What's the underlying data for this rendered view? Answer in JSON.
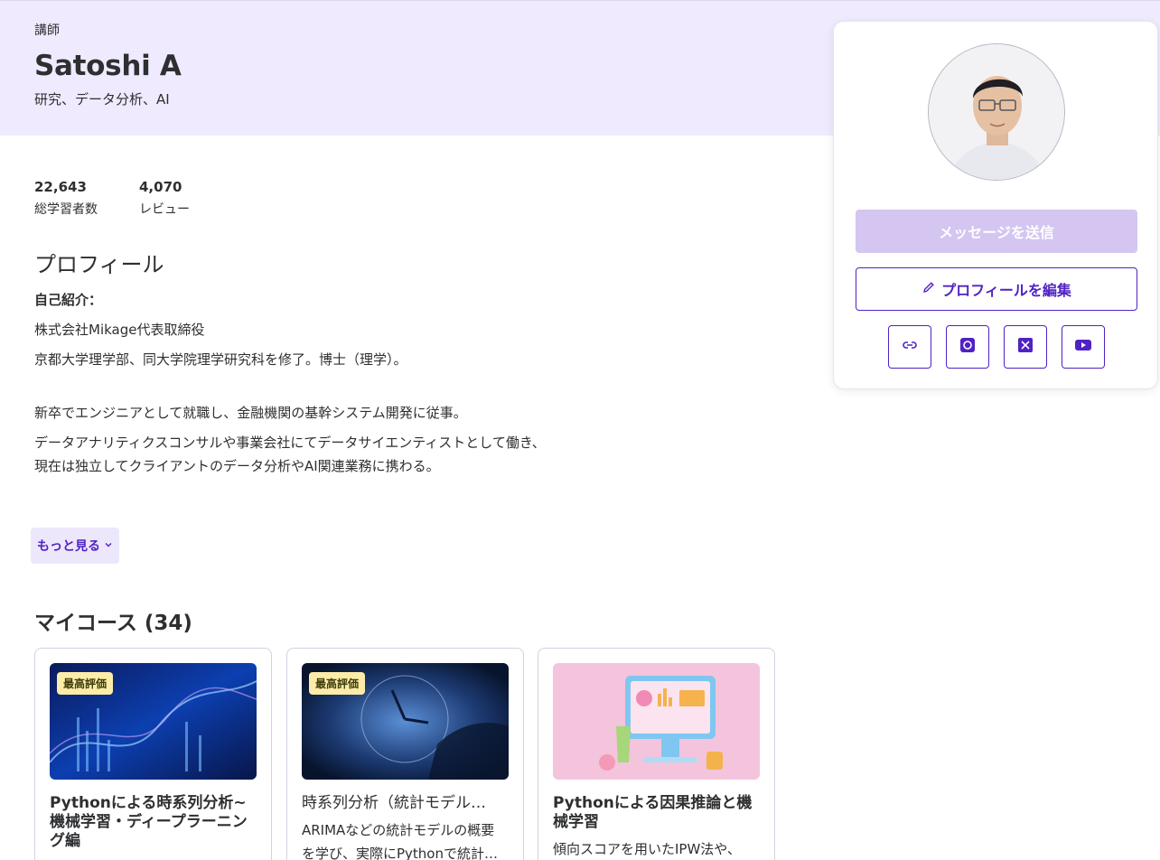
{
  "header": {
    "role": "講師",
    "name": "Satoshi A",
    "tagline": "研究、データ分析、AI"
  },
  "stats": [
    {
      "value": "22,643",
      "label": "総学習者数"
    },
    {
      "value": "4,070",
      "label": "レビュー"
    }
  ],
  "profile": {
    "section_title": "プロフィール",
    "intro_heading": "自己紹介：",
    "lines": [
      "株式会社Mikage代表取締役",
      "京都大学理学部、同大学院理学研究科を修了。博士（理学）。",
      "新卒でエンジニアとして就職し、金融機関の基幹システム開発に従事。",
      "データアナリティクスコンサルや事業会社にてデータサイエンティストとして働き、現在は独立してクライアントのデータ分析やAI関連業務に携わる。"
    ],
    "more_label": "もっと見る",
    "more_icon": "chevron-down-icon"
  },
  "courses": {
    "title": "マイコース (34)",
    "items": [
      {
        "badge": "最高評価",
        "title": "Pythonによる時系列分析~機械学習・ディープラーニング編",
        "desc": "",
        "thumb": "blue-data-wave"
      },
      {
        "badge": "最高評価",
        "title": "時系列分析（統計モデル…",
        "desc1": "ARIMAなどの統計モデルの概要",
        "desc2": "を学び、実際にPythonで統計…",
        "thumb": "clock-hands"
      },
      {
        "badge": "",
        "title": "Pythonによる因果推論と機械学習",
        "desc1": "傾向スコアを用いたIPW法や、",
        "thumb": "pink-dashboard"
      }
    ]
  },
  "sidebar": {
    "message_label": "メッセージを送信",
    "edit_label": "プロフィールを編集",
    "social_icons": [
      "link-icon",
      "instagram-icon",
      "x-icon",
      "youtube-icon"
    ]
  },
  "colors": {
    "accent": "#5022c3",
    "hero_bg": "#efeafd",
    "badge_bg": "#fceca8",
    "disabled_btn": "#d4c6f1"
  }
}
